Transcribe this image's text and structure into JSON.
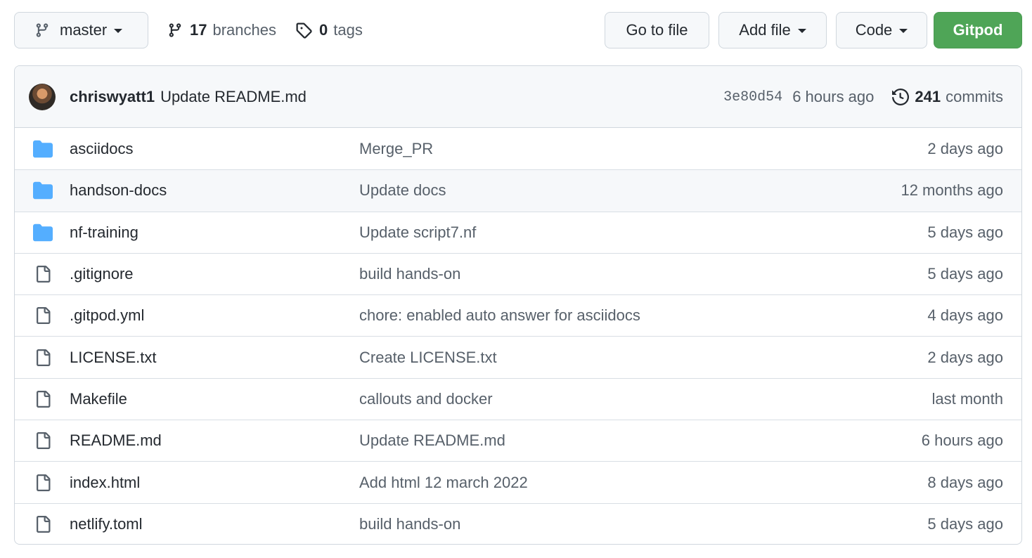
{
  "toolbar": {
    "branch_name": "master",
    "branches_count": "17",
    "branches_label": "branches",
    "tags_count": "0",
    "tags_label": "tags",
    "go_to_file": "Go to file",
    "add_file": "Add file",
    "code": "Code",
    "gitpod": "Gitpod"
  },
  "commit": {
    "author": "chriswyatt1",
    "message": "Update README.md",
    "sha": "3e80d54",
    "time": "6 hours ago",
    "commits_count": "241",
    "commits_label": "commits"
  },
  "files": [
    {
      "name": "asciidocs",
      "type": "folder",
      "message": "Merge_PR",
      "age": "2 days ago"
    },
    {
      "name": "handson-docs",
      "type": "folder",
      "message": "Update docs",
      "age": "12 months ago"
    },
    {
      "name": "nf-training",
      "type": "folder",
      "message": "Update script7.nf",
      "age": "5 days ago"
    },
    {
      "name": ".gitignore",
      "type": "file",
      "message": "build hands-on",
      "age": "5 days ago"
    },
    {
      "name": ".gitpod.yml",
      "type": "file",
      "message": "chore: enabled auto answer for asciidocs",
      "age": "4 days ago"
    },
    {
      "name": "LICENSE.txt",
      "type": "file",
      "message": "Create LICENSE.txt",
      "age": "2 days ago"
    },
    {
      "name": "Makefile",
      "type": "file",
      "message": "callouts and docker",
      "age": "last month"
    },
    {
      "name": "README.md",
      "type": "file",
      "message": "Update README.md",
      "age": "6 hours ago"
    },
    {
      "name": "index.html",
      "type": "file",
      "message": "Add html 12 march 2022",
      "age": "8 days ago"
    },
    {
      "name": "netlify.toml",
      "type": "file",
      "message": "build hands-on",
      "age": "5 days ago"
    }
  ],
  "colors": {
    "folder": "#54aeff",
    "file_icon": "#57606a",
    "gitpod_bg": "#4fa557"
  }
}
